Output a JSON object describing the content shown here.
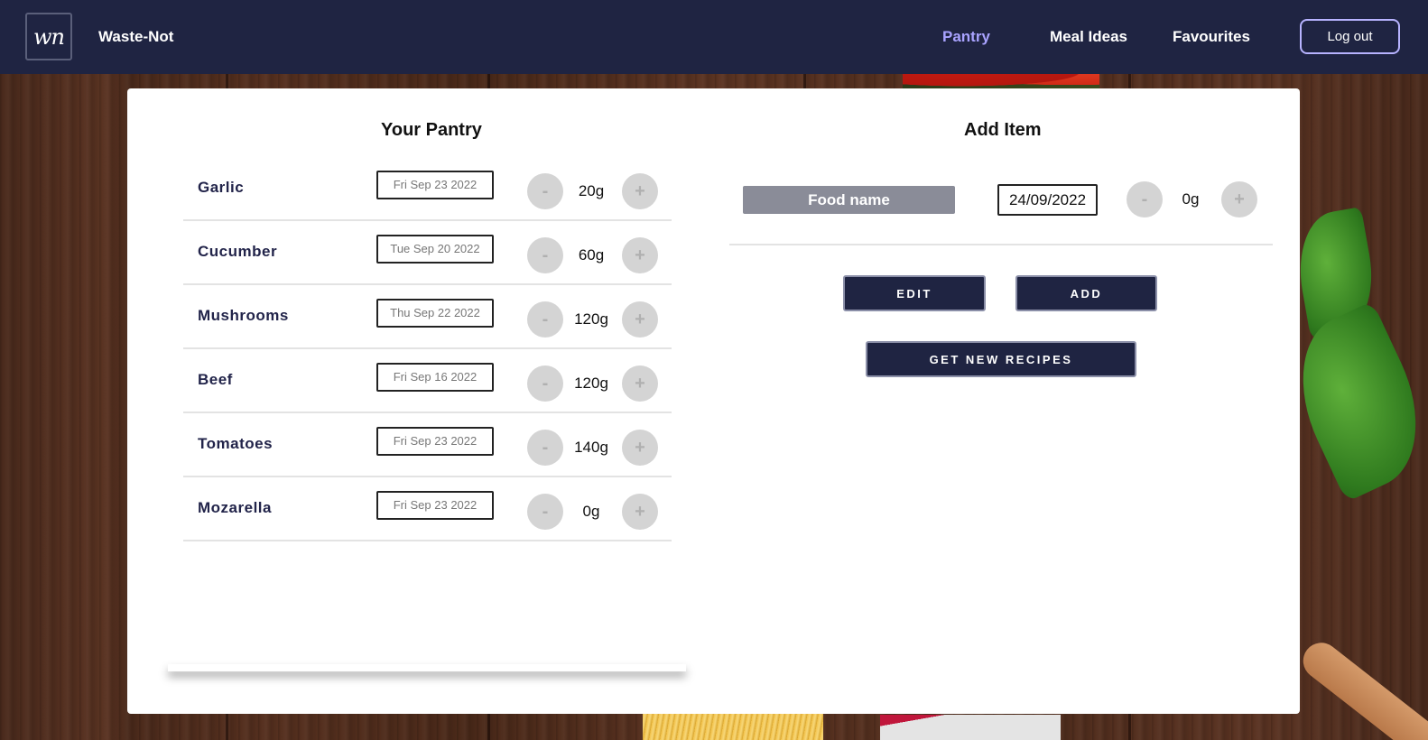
{
  "colors": {
    "navbar": "#1f2442",
    "active_link": "#a9a3ff",
    "item_name": "#22244a",
    "food_input_bg": "#8a8c98"
  },
  "navbar": {
    "logo_text": "wn",
    "brand": "Waste-Not",
    "links": [
      {
        "label": "Pantry",
        "active": true
      },
      {
        "label": "Meal Ideas",
        "active": false
      },
      {
        "label": "Favourites",
        "active": false
      }
    ],
    "logout_label": "Log out"
  },
  "pantry": {
    "title": "Your Pantry",
    "items": [
      {
        "name": "Garlic",
        "date": "Fri Sep 23 2022",
        "qty": "20g"
      },
      {
        "name": "Cucumber",
        "date": "Tue Sep 20 2022",
        "qty": "60g"
      },
      {
        "name": "Mushrooms",
        "date": "Thu Sep 22 2022",
        "qty": "120g"
      },
      {
        "name": "Beef",
        "date": "Fri Sep 16 2022",
        "qty": "120g"
      },
      {
        "name": "Tomatoes",
        "date": "Fri Sep 23 2022",
        "qty": "140g"
      },
      {
        "name": "Mozarella",
        "date": "Fri Sep 23 2022",
        "qty": "0g"
      }
    ],
    "minus_label": "-",
    "plus_label": "+"
  },
  "add_item": {
    "title": "Add Item",
    "food_placeholder": "Food name",
    "date_value": "24/09/2022",
    "qty": "0g",
    "minus_label": "-",
    "plus_label": "+",
    "edit_label": "EDIT",
    "add_label": "ADD",
    "recipes_label": "GET NEW RECIPES"
  }
}
